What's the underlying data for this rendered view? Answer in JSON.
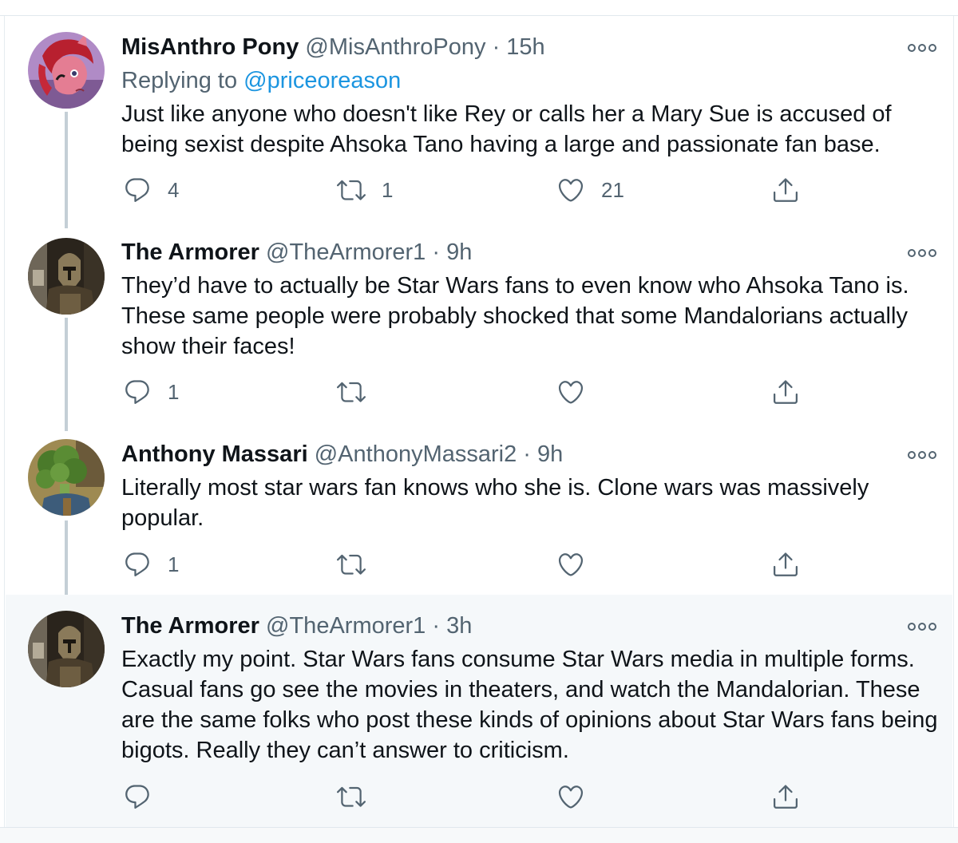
{
  "tweets": [
    {
      "name": "MisAnthro Pony",
      "handle": "@MisAnthroPony",
      "separator": "·",
      "time": "15h",
      "replying_prefix": "Replying to ",
      "replying_to": "@priceoreason",
      "text": "Just like anyone who doesn't like Rey or calls her a Mary Sue is accused of being sexist despite Ahsoka Tano having a large and passionate fan base.",
      "replies": "4",
      "retweets": "1",
      "likes": "21",
      "avatar_icon": "pony-avatar"
    },
    {
      "name": "The Armorer",
      "handle": "@TheArmorer1",
      "separator": "·",
      "time": "9h",
      "text": "They’d have to actually be Star Wars fans to even know who Ahsoka Tano is. These same people were probably shocked that some Mandalorians actually show their faces!",
      "replies": "1",
      "retweets": "",
      "likes": "",
      "avatar_icon": "armorer-avatar"
    },
    {
      "name": "Anthony Massari",
      "handle": "@AnthonyMassari2",
      "separator": "·",
      "time": "9h",
      "text": "Literally most star wars fan knows who she is. Clone wars was massively popular.",
      "replies": "1",
      "retweets": "",
      "likes": "",
      "avatar_icon": "broccoli-avatar"
    },
    {
      "name": "The Armorer",
      "handle": "@TheArmorer1",
      "separator": "·",
      "time": "3h",
      "text": "Exactly my point. Star Wars fans consume Star Wars media in multiple forms. Casual fans go see the movies in theaters, and watch the Mandalorian. These are the same folks who post these kinds of opinions about Star Wars fans being bigots. Really they can’t answer to criticism.",
      "replies": "",
      "retweets": "",
      "likes": "",
      "avatar_icon": "armorer-avatar"
    }
  ],
  "icons": {
    "reply": "reply-icon",
    "retweet": "retweet-icon",
    "like": "heart-icon",
    "share": "share-icon",
    "more": "more-icon"
  },
  "colors": {
    "text": "#0f1419",
    "secondary": "#536471",
    "link": "#1b95e0",
    "thread_line": "#c4cfd6",
    "highlight_bg": "#f5f8fa"
  }
}
